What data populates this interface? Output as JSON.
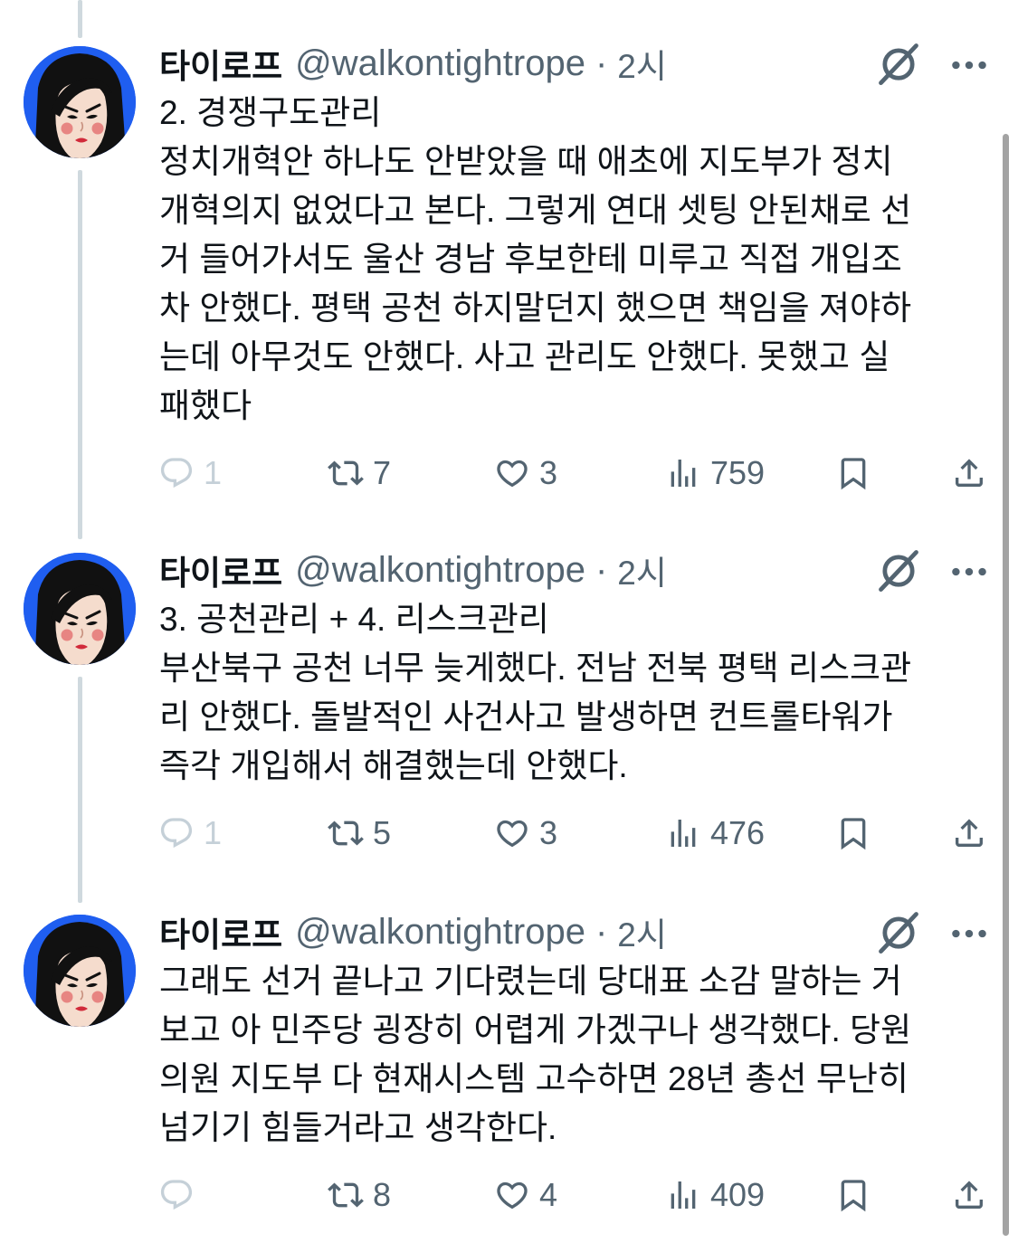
{
  "colors": {
    "background": "#ffffff",
    "text": "#0f1419",
    "secondary": "#536471",
    "muted": "#c5d0d8",
    "thread_line": "#cfd9de",
    "avatar_background": "#1f5ef0",
    "scroll_indicator": "#a3a3a3"
  },
  "icons": {
    "header": [
      "grok-icon",
      "more-icon"
    ],
    "actions": [
      "reply-icon",
      "retweet-icon",
      "heart-icon",
      "views-icon",
      "bookmark-icon",
      "share-icon"
    ]
  },
  "tweets": [
    {
      "author_name": "타이로프",
      "handle": "@walkontightrope",
      "separator": "·",
      "time": "2시",
      "lines": [
        "2. 경쟁구도관리",
        "정치개혁안 하나도 안받았을 때 애초에 지도부가 정치",
        "개혁의지 없었다고 본다. 그렇게 연대 셋팅 안된채로 선",
        "거 들어가서도 울산 경남 후보한테 미루고 직접 개입조",
        "차 안했다. 평택 공천 하지말던지 했으면 책임을 져야하",
        "는데 아무것도 안했다. 사고 관리도 안했다. 못했고 실",
        "패했다"
      ],
      "replies": "1",
      "reposts": "7",
      "likes": "3",
      "views": "759"
    },
    {
      "author_name": "타이로프",
      "handle": "@walkontightrope",
      "separator": "·",
      "time": "2시",
      "lines": [
        "3. 공천관리 + 4. 리스크관리",
        "부산북구 공천 너무 늦게했다. 전남 전북 평택 리스크관",
        "리 안했다. 돌발적인 사건사고 발생하면 컨트롤타워가",
        "즉각 개입해서 해결했는데 안했다."
      ],
      "replies": "1",
      "reposts": "5",
      "likes": "3",
      "views": "476"
    },
    {
      "author_name": "타이로프",
      "handle": "@walkontightrope",
      "separator": "·",
      "time": "2시",
      "lines": [
        "그래도 선거 끝나고 기다렸는데 당대표 소감 말하는 거",
        "보고 아 민주당 굉장히 어렵게 가겠구나 생각했다. 당원",
        "의원 지도부 다 현재시스템 고수하면 28년 총선 무난히",
        "넘기기 힘들거라고 생각한다."
      ],
      "replies": "",
      "reposts": "8",
      "likes": "4",
      "views": "409"
    }
  ]
}
